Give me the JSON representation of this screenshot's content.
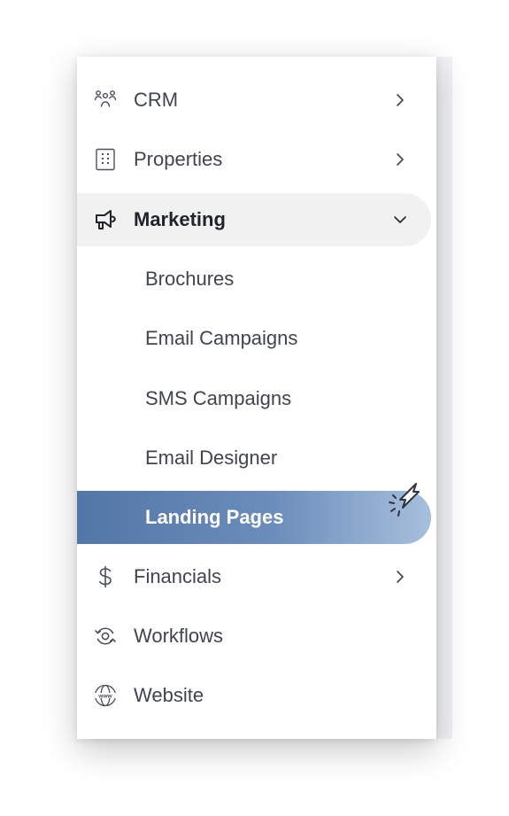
{
  "menu": {
    "items": [
      {
        "label": "CRM",
        "icon": "users-icon"
      },
      {
        "label": "Properties",
        "icon": "building-icon"
      },
      {
        "label": "Marketing",
        "icon": "megaphone-icon"
      },
      {
        "label": "Financials",
        "icon": "dollar-icon"
      },
      {
        "label": "Workflows",
        "icon": "workflow-icon"
      },
      {
        "label": "Website",
        "icon": "www-globe-icon"
      }
    ],
    "marketing_submenu": [
      {
        "label": "Brochures"
      },
      {
        "label": "Email Campaigns"
      },
      {
        "label": "SMS Campaigns"
      },
      {
        "label": "Email Designer"
      },
      {
        "label": "Landing Pages",
        "selected": true
      }
    ]
  },
  "colors": {
    "active_bg": "#f1f1f2",
    "selected_gradient_start": "#5276a7",
    "selected_gradient_end": "#a7bfdc",
    "text": "#3f4450"
  }
}
